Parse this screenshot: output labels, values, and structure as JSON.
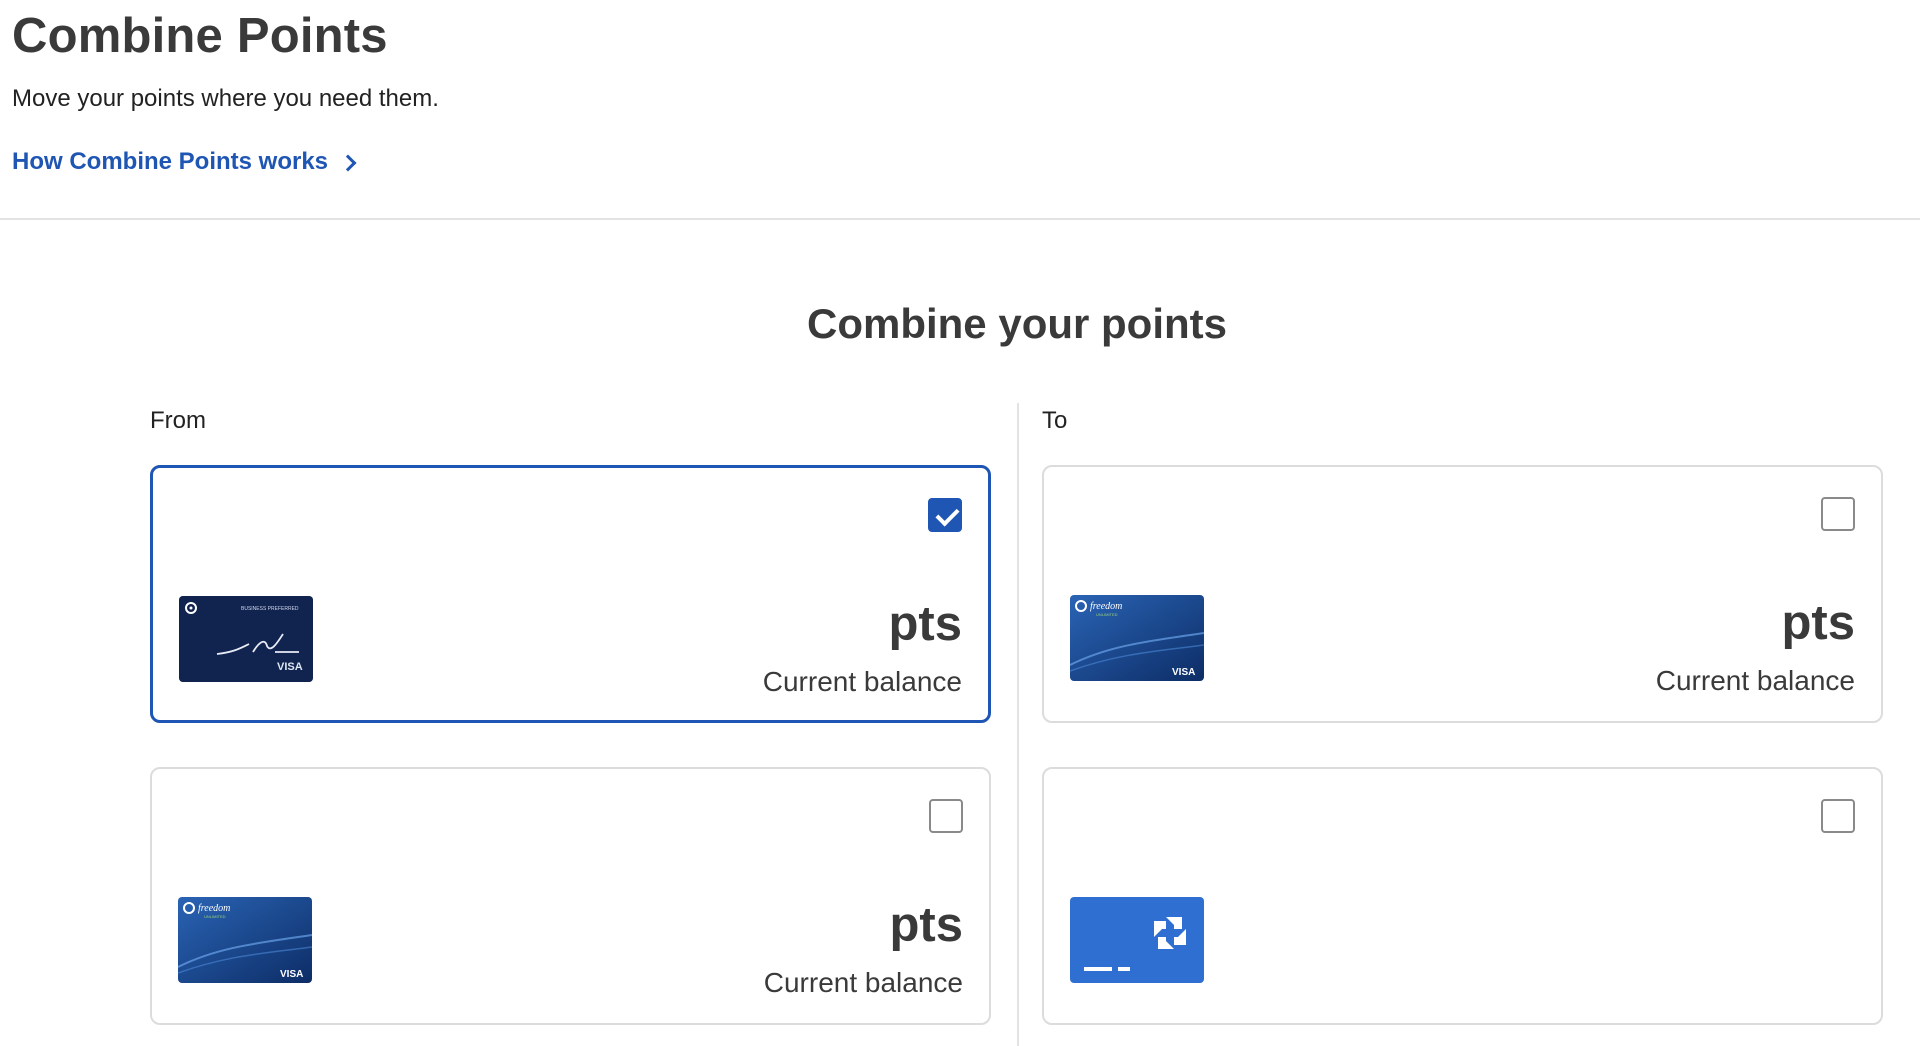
{
  "header": {
    "title": "Combine Points",
    "subtitle": "Move your points where you need them.",
    "how_link": "How Combine Points works"
  },
  "main": {
    "section_title": "Combine your points",
    "from_label": "From",
    "to_label": "To"
  },
  "from_cards": [
    {
      "card": "ink-business-preferred-visa",
      "checked": true,
      "points_unit": "pts",
      "balance_label": "Current balance"
    },
    {
      "card": "freedom-unlimited-visa",
      "checked": false,
      "points_unit": "pts",
      "balance_label": "Current balance"
    }
  ],
  "to_cards": [
    {
      "card": "freedom-unlimited-visa",
      "checked": false,
      "points_unit": "pts",
      "balance_label": "Current balance"
    },
    {
      "card": "generic-chase-card",
      "checked": false
    }
  ],
  "card_art_text": {
    "ink": "BUSINESS PREFERRED",
    "freedom": "freedom",
    "freedom_sub": "UNLIMITED",
    "visa": "VISA"
  },
  "colors": {
    "accent": "#1f56b3",
    "border": "#dcdcdc",
    "text": "#3a3a3a",
    "ink_card": "#0f1e45",
    "freedom_card": "#1d4f99",
    "chase_card": "#2f6fd1"
  }
}
